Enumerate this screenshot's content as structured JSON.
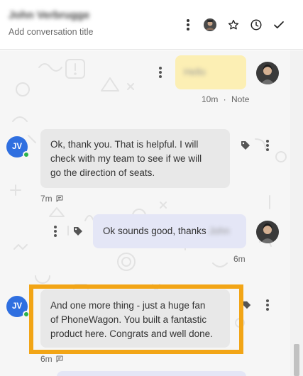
{
  "header": {
    "contact_name": "John Verbrugge",
    "conversation_title_placeholder": "Add conversation title",
    "icons": [
      "more-vert-icon",
      "assignee-avatar",
      "star-icon",
      "clock-icon",
      "check-icon"
    ]
  },
  "messages": [
    {
      "type": "note",
      "direction": "outgoing",
      "text": "Hello",
      "time": "10m",
      "separator": " · ",
      "label": "Note"
    },
    {
      "type": "message",
      "direction": "incoming",
      "sender_initials": "JV",
      "text_lines": [
        "Ok, thank you. That is helpful. I will",
        "check with my team to see if we will",
        "go the direction of seats."
      ],
      "time": "7m",
      "status_icon": "sms-icon"
    },
    {
      "type": "message",
      "direction": "outgoing",
      "text": "Ok sounds good, thanks",
      "redacted_name": "John",
      "time": "6m"
    },
    {
      "type": "message",
      "direction": "incoming",
      "sender_initials": "JV",
      "text_lines": [
        "And one more thing - just a huge fan",
        "of PhoneWagon. You built a fantastic",
        "product here. Congrats and well done."
      ],
      "time": "6m",
      "status_icon": "sms-icon"
    }
  ],
  "colors": {
    "incoming_bubble": "#e8e8e8",
    "outgoing_bubble": "#e4e6f6",
    "note_bubble": "#fcefb4",
    "avatar_jv": "#2f6fe0",
    "online": "#2bb24c",
    "highlight_border": "#f2a516"
  }
}
